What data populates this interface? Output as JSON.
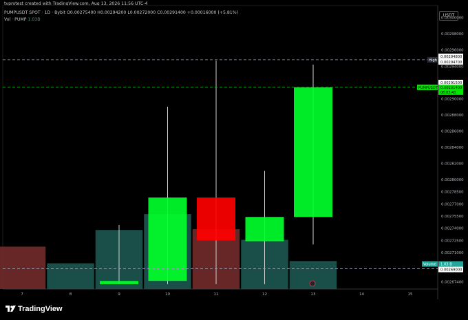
{
  "header": {
    "caption": "tvprotest created with TradingView.com, Aug 13, 2026 11:56 UTC-4",
    "symbol_line": "PUMPUSDT SPOT · 1D · Bybit",
    "ohlc": "O0.00275400 H0.00294200 L0.00272000 C0.00291400 +0.00016000 (+5.81%)",
    "volume_label": "Vol · PUMP",
    "volume_value": "1.03B"
  },
  "currency_button": "USDT",
  "branding": {
    "name": "TradingView"
  },
  "chart_data": {
    "type": "candlestick",
    "symbol": "PUMPUSDT",
    "timeframe": "1D",
    "exchange": "Bybit",
    "x_ticks": [
      "7",
      "8",
      "9",
      "10",
      "11",
      "12",
      "13",
      "14",
      "15"
    ],
    "y_ticks": [
      "0.00300000",
      "0.00298000",
      "0.00296000",
      "0.00294000",
      "0.00290000",
      "0.00288000",
      "0.00286000",
      "0.00284000",
      "0.00282000",
      "0.00280000",
      "0.00278500",
      "0.00277000",
      "0.00275500",
      "0.00274000",
      "0.00272500",
      "0.00271000",
      "0.00267400"
    ],
    "ylim": [
      0.002665,
      0.003015
    ],
    "candles": [
      {
        "x": "7",
        "open": null,
        "high": null,
        "low": null,
        "close": null,
        "volume_rel": 0.56,
        "volume_color": "#7a2e2e"
      },
      {
        "x": "8",
        "open": null,
        "high": null,
        "low": null,
        "close": null,
        "volume_rel": 0.34,
        "volume_color": "#1f5c55"
      },
      {
        "x": "9",
        "open": 0.002671,
        "high": 0.002744,
        "low": 0.002671,
        "close": 0.002675,
        "volume_rel": 0.78,
        "volume_color": "#1f5c55"
      },
      {
        "x": "10",
        "open": 0.002675,
        "high": 0.00289,
        "low": 0.002671,
        "close": 0.002778,
        "volume_rel": 0.99,
        "volume_color": "#1f5c55"
      },
      {
        "x": "11",
        "open": 0.002778,
        "high": 0.002947,
        "low": 0.002671,
        "close": 0.002725,
        "volume_rel": 0.79,
        "volume_color": "#7a2e2e"
      },
      {
        "x": "12",
        "open": 0.002724,
        "high": 0.002811,
        "low": 0.002671,
        "close": 0.002754,
        "volume_rel": 0.65,
        "volume_color": "#1f5c55"
      },
      {
        "x": "13",
        "open": 0.002754,
        "high": 0.002942,
        "low": 0.00272,
        "close": 0.002914,
        "volume_rel": 0.37,
        "volume_color": "#1f5c55"
      }
    ],
    "lines": [
      {
        "name": "High",
        "value": "0.00294800",
        "color": "#9aa0b5",
        "label_bg": "#2a2e39"
      },
      {
        "name": "PUMPUSDT",
        "value": "0.00291400",
        "countdown": "08:03:43",
        "color": "#00e600",
        "label_bg": "#00e600"
      },
      {
        "name": "Volume",
        "value": "1.03 B",
        "color": "#26a69a",
        "label_bg": "#26a69a"
      }
    ],
    "price_labels": {
      "high_extra": "0.00294700",
      "current_extra": "0.00291500",
      "volume_level": "0.00269000"
    }
  }
}
